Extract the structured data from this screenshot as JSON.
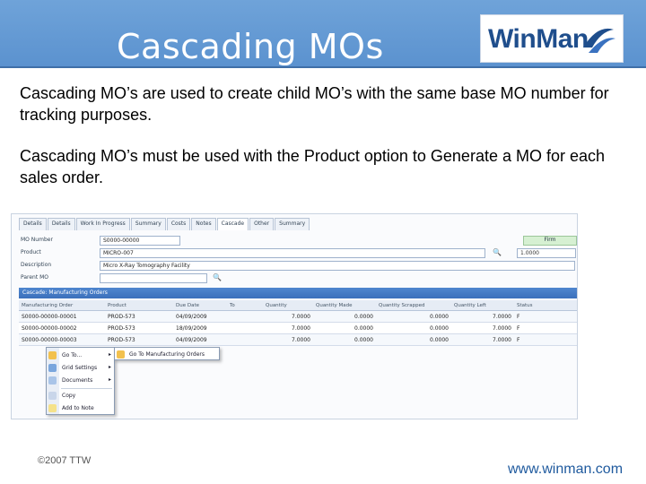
{
  "header": {
    "title": "Cascading MOs",
    "logo_text": "WinMan"
  },
  "body": {
    "paragraph1": "Cascading MO’s are used to create child MO’s with the same base MO number for tracking purposes.",
    "paragraph2": "Cascading MO’s must be used with the Product option to Generate a MO for each sales order."
  },
  "app": {
    "tabs": [
      "Details",
      "Details",
      "Work In Progress",
      "Summary",
      "Costs",
      "Notes",
      "Cascade",
      "Other",
      "Summary"
    ],
    "form": {
      "mo_number_label": "MO Number",
      "mo_number_value": "S0000-00000",
      "product_label": "Product",
      "product_value": "MICRO-007",
      "description_label": "Description",
      "description_value": "Micro X-Ray Tomography Facility",
      "parent_label": "Parent MO",
      "status_value": "Firm",
      "qty_value": "1.0000"
    },
    "grid_title": "Cascade: Manufacturing Orders",
    "columns": [
      "Manufacturing Order",
      "Product",
      "Due Date",
      "To",
      "Quantity",
      "Quantity Made",
      "Quantity Scrapped",
      "Quantity Left",
      "Status"
    ],
    "rows": [
      [
        "S0000-00000-00001",
        "PROD-573",
        "04/09/2009",
        "",
        "7.0000",
        "0.0000",
        "0.0000",
        "7.0000",
        "F"
      ],
      [
        "S0000-00000-00002",
        "PROD-573",
        "18/09/2009",
        "",
        "7.0000",
        "0.0000",
        "0.0000",
        "7.0000",
        "F"
      ],
      [
        "S0000-00000-00003",
        "PROD-573",
        "04/09/2009",
        "",
        "7.0000",
        "0.0000",
        "0.0000",
        "7.0000",
        "F"
      ]
    ],
    "context_menu": {
      "items": [
        "Go To...",
        "Grid Settings",
        "Documents",
        "Copy",
        "Add to Note"
      ],
      "submenu": "Go To Manufacturing Orders"
    }
  },
  "footer": {
    "copyright": "©2007 TTW",
    "url": "www.winman.com"
  },
  "colors": {
    "header_bg": "#5b92cf",
    "title": "#ffffff",
    "link": "#1f5a9e"
  }
}
